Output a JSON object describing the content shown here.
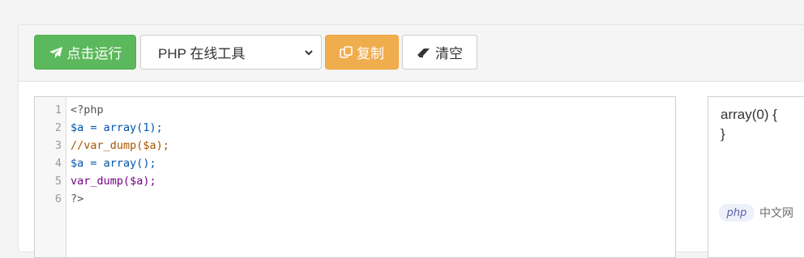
{
  "toolbar": {
    "run_label": "点击运行",
    "select_value": "PHP 在线工具",
    "copy_label": "复制",
    "clear_label": "清空"
  },
  "editor": {
    "lines": [
      {
        "no": "1",
        "text": "<?php"
      },
      {
        "no": "2",
        "text": "$a = array(1);"
      },
      {
        "no": "3",
        "text": "//var_dump($a);"
      },
      {
        "no": "4",
        "text": "$a = array();"
      },
      {
        "no": "5",
        "text": "var_dump($a);"
      },
      {
        "no": "6",
        "text": "?>"
      }
    ]
  },
  "output": {
    "lines": [
      "array(0) {",
      "}"
    ]
  },
  "watermark": {
    "logo": "php",
    "text": "中文网"
  },
  "colors": {
    "run_button": "#5cb85c",
    "copy_button": "#f0ad4e",
    "variable": "#05a",
    "keyword": "#708",
    "comment": "#a50",
    "php_tag": "#555"
  }
}
